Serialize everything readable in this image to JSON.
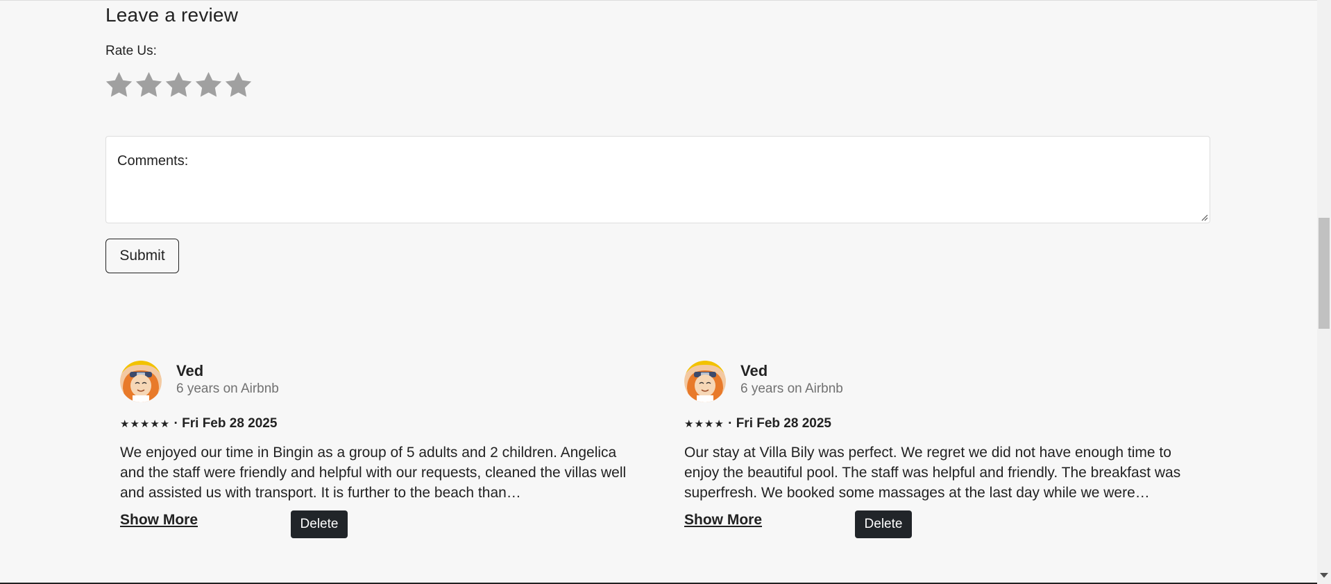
{
  "review_form": {
    "title": "Leave a review",
    "rate_label": "Rate Us:",
    "rating_selected": 0,
    "rating_max": 5,
    "comments_placeholder": "Comments:",
    "submit_label": "Submit"
  },
  "reviews": [
    {
      "name": "Ved",
      "tenure": "6 years on Airbnb",
      "stars": "★★★★★",
      "rating": 5,
      "date": "Fri Feb 28 2025",
      "body": "We enjoyed our time in Bingin as a group of 5 adults and 2 children. Angelica and the staff were friendly and helpful with our requests, cleaned the villas well and assisted us with transport. It is further to the beach than…",
      "show_more_label": "Show More",
      "delete_label": "Delete"
    },
    {
      "name": "Ved",
      "tenure": "6 years on Airbnb",
      "stars": "★★★★",
      "rating": 4,
      "date": "Fri Feb 28 2025",
      "body": "Our stay at Villa Bily was perfect. We regret we did not have enough time to enjoy the beautiful pool. The staff was helpful and friendly. The breakfast was superfresh. We booked some massages at the last day while we were…",
      "show_more_label": "Show More",
      "delete_label": "Delete"
    }
  ],
  "colors": {
    "page_bg": "#f7f7f7",
    "text": "#222222",
    "muted": "#717171",
    "star_empty": "#a0a0a0",
    "delete_bg": "#212529"
  },
  "icons": {
    "star": "star-icon",
    "avatar": "user-avatar"
  }
}
